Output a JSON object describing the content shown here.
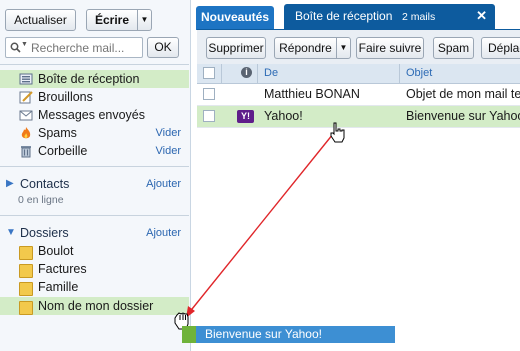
{
  "toolbar_left": {
    "refresh_label": "Actualiser",
    "compose_label": "Écrire",
    "search_placeholder": "Recherche mail...",
    "search_ok_label": "OK"
  },
  "sidebar": {
    "folders": [
      {
        "label": "Boîte de réception",
        "icon": "inbox-icon",
        "selected": true
      },
      {
        "label": "Brouillons",
        "icon": "drafts-icon"
      },
      {
        "label": "Messages envoyés",
        "icon": "sent-icon"
      },
      {
        "label": "Spams",
        "icon": "spam-icon",
        "action": "Vider"
      },
      {
        "label": "Corbeille",
        "icon": "trash-icon",
        "action": "Vider"
      }
    ],
    "contacts": {
      "title": "Contacts",
      "action": "Ajouter",
      "status": "0 en ligne"
    },
    "dossiers": {
      "title": "Dossiers",
      "action": "Ajouter",
      "items": [
        "Boulot",
        "Factures",
        "Famille",
        "Nom de mon dossier"
      ]
    }
  },
  "tabs": {
    "inactive": "Nouveautés",
    "active": "Boîte de réception",
    "active_count": "2 mails",
    "close_glyph": "✕"
  },
  "mail_toolbar": {
    "delete": "Supprimer",
    "reply": "Répondre",
    "forward": "Faire suivre",
    "spam": "Spam",
    "move": "Déplac"
  },
  "grid": {
    "headers": {
      "from": "De",
      "subject": "Objet"
    },
    "rows": [
      {
        "from": "Matthieu BONAN",
        "subject": "Objet de mon mail te",
        "selected": false,
        "sender_logo": ""
      },
      {
        "from": "Yahoo!",
        "subject": "Bienvenue sur Yahoo!",
        "selected": true,
        "sender_logo": "Y!"
      }
    ]
  },
  "drag": {
    "ghost_label": "Bienvenue sur Yahoo!",
    "hover_folder": "Nom de mon dossier",
    "arrow_color": "#e0262a"
  },
  "colors": {
    "accent_blue": "#1d74c3",
    "selection_green": "#d3ecc7",
    "link_blue": "#2b66b0"
  }
}
